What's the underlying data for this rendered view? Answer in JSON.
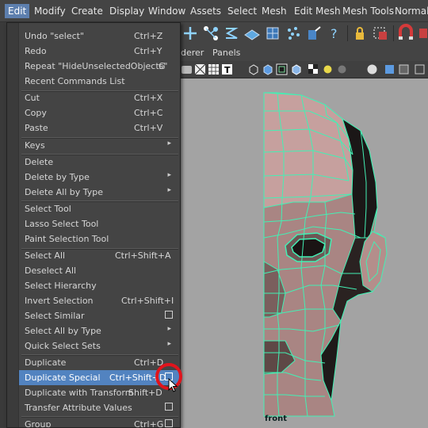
{
  "menubar": {
    "items": [
      {
        "label": "Edit",
        "active": true
      },
      {
        "label": "Modify"
      },
      {
        "label": "Create"
      },
      {
        "label": "Display"
      },
      {
        "label": "Window"
      },
      {
        "label": "Assets"
      },
      {
        "label": "Select"
      },
      {
        "label": "Mesh"
      },
      {
        "label": "Edit Mesh"
      },
      {
        "label": "Mesh Tools"
      },
      {
        "label": "Normals"
      }
    ]
  },
  "panel_menu": {
    "items": [
      {
        "label": "derer"
      },
      {
        "label": "Panels"
      }
    ]
  },
  "viewport": {
    "camera_label": "front",
    "wire_color": "#43f0b4",
    "background_color": "#a3a3a3"
  },
  "edit_menu": {
    "items": [
      {
        "label": "Undo \"select\"",
        "shortcut": "Ctrl+Z"
      },
      {
        "label": "Redo",
        "shortcut": "Ctrl+Y"
      },
      {
        "label": "Repeat \"HideUnselectedObjects\"",
        "shortcut": "G"
      },
      {
        "label": "Recent Commands List"
      },
      {
        "label": "Cut",
        "shortcut": "Ctrl+X"
      },
      {
        "label": "Copy",
        "shortcut": "Ctrl+C"
      },
      {
        "label": "Paste",
        "shortcut": "Ctrl+V"
      },
      {
        "label": "Keys",
        "submenu": true
      },
      {
        "label": "Delete"
      },
      {
        "label": "Delete by Type",
        "submenu": true
      },
      {
        "label": "Delete All by Type",
        "submenu": true
      },
      {
        "label": "Select Tool"
      },
      {
        "label": "Lasso Select Tool"
      },
      {
        "label": "Paint Selection Tool"
      },
      {
        "label": "Select All",
        "shortcut": "Ctrl+Shift+A"
      },
      {
        "label": "Deselect All"
      },
      {
        "label": "Select Hierarchy"
      },
      {
        "label": "Invert Selection",
        "shortcut": "Ctrl+Shift+I"
      },
      {
        "label": "Select Similar",
        "option_box": true
      },
      {
        "label": "Select All by Type",
        "submenu": true
      },
      {
        "label": "Quick Select Sets",
        "submenu": true
      },
      {
        "label": "Duplicate",
        "shortcut": "Ctrl+D"
      },
      {
        "label": "Duplicate Special",
        "shortcut": "Ctrl+Shift+D",
        "option_box": true,
        "highlighted": true
      },
      {
        "label": "Duplicate with Transform",
        "shortcut": "Shift+D"
      },
      {
        "label": "Transfer Attribute Values",
        "option_box": true
      },
      {
        "label": "Group",
        "shortcut": "Ctrl+G",
        "option_box": true
      }
    ]
  },
  "colors": {
    "highlight": "#5283c0",
    "annotation_ring": "#e0141c",
    "menu_background": "#444444"
  }
}
